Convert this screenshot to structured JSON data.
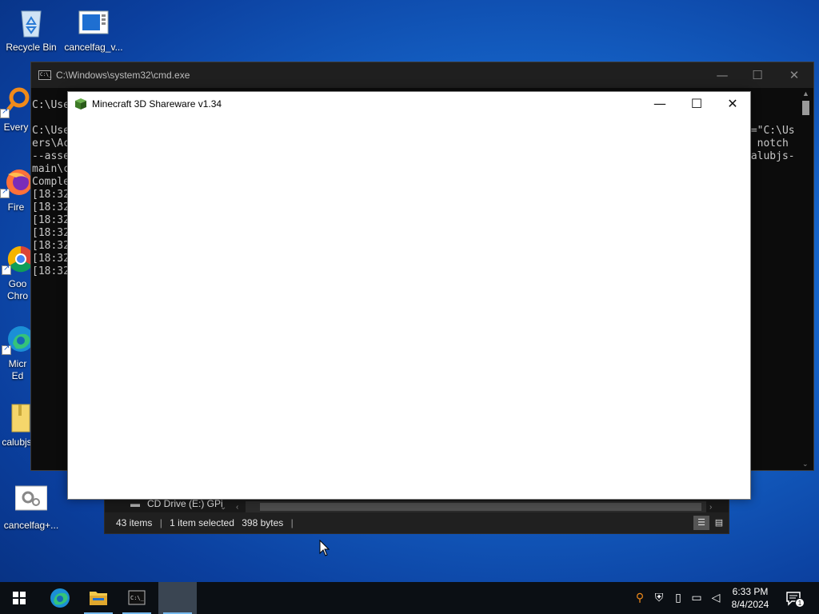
{
  "desktop": {
    "icons": [
      {
        "label": "Recycle Bin"
      },
      {
        "label": "cancelfag_v..."
      },
      {
        "label": "Every"
      },
      {
        "label": "Fire"
      },
      {
        "label": "Goo\nChro"
      },
      {
        "label": "Micr\nEd"
      },
      {
        "label": "calubjs"
      },
      {
        "label": "cancelfag+..."
      }
    ]
  },
  "cmd": {
    "title": "C:\\Windows\\system32\\cmd.exe",
    "lines": [
      "C:\\Use",
      "",
      "C:\\Use",
      "ers\\Ac",
      "--asse",
      "main\\c",
      "Comple",
      "[18:32",
      "[18:32",
      "[18:32",
      "[18:32",
      "[18:32",
      "[18:32",
      "[18:32"
    ],
    "right_lines": [
      "n=\"C:\\Us",
      "n notch",
      "calubjs-"
    ]
  },
  "minecraft": {
    "title": "Minecraft 3D Shareware v1.34"
  },
  "explorer": {
    "drive_label": "CD Drive (E:) GPi",
    "status_items": "43 items",
    "status_selected": "1 item selected",
    "status_size": "398 bytes"
  },
  "taskbar": {
    "time": "6:33 PM",
    "date": "8/4/2024",
    "notification_count": "1"
  },
  "colors": {
    "accent": "#76b9ed",
    "desktop": "#1667cc"
  }
}
